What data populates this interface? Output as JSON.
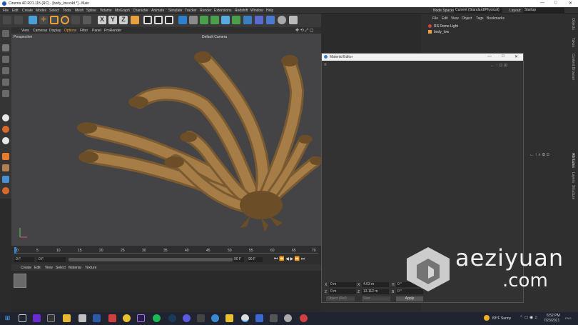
{
  "window": {
    "title": "Cinema 4D R21.115 (RC) - [body_low.c4d *] - Main"
  },
  "menubar": {
    "items": [
      "File",
      "Edit",
      "Create",
      "Modes",
      "Select",
      "Tools",
      "Mesh",
      "Spline",
      "Volume",
      "MoGraph",
      "Character",
      "Animate",
      "Simulate",
      "Tracker",
      "Render",
      "Extensions",
      "Redshift",
      "Window",
      "Help"
    ],
    "node_spaces_label": "Node Spaces:",
    "node_spaces_value": "Current (Standard/Physical)",
    "layout_label": "Layout:",
    "layout_value": "Startup"
  },
  "viewport": {
    "menu": [
      "View",
      "Cameras",
      "Display",
      "Options",
      "Filter",
      "Panel",
      "ProRender"
    ],
    "label": "Perspective",
    "camera": "Default Camera"
  },
  "timeline": {
    "ticks": [
      "0",
      "5",
      "10",
      "15",
      "20",
      "25",
      "30",
      "35",
      "40",
      "45",
      "50",
      "55",
      "60",
      "65",
      "70"
    ],
    "current": "0 F",
    "start": "0 F",
    "end": "90 F",
    "end2": "90 F"
  },
  "material_manager": {
    "menu": [
      "Create",
      "Edit",
      "View",
      "Select",
      "Material",
      "Texture"
    ]
  },
  "object_manager": {
    "menu": [
      "File",
      "Edit",
      "View",
      "Object",
      "Tags",
      "Bookmarks"
    ],
    "objects": [
      {
        "name": "RS Dome Light"
      },
      {
        "name": "body_low"
      }
    ]
  },
  "right_tabs": [
    "Objects",
    "Takes",
    "Content Browser",
    "Attributes",
    "Layers",
    "Structure"
  ],
  "material_editor": {
    "title": "Material Editor"
  },
  "coords": {
    "rows": [
      {
        "axis": "X",
        "pos": "0 m",
        "axis2": "X",
        "size": "4.03 m",
        "axis3": "H",
        "rot": "0 °"
      },
      {
        "axis": "Z",
        "pos": "0 m",
        "axis2": "Z",
        "size": "13.112 m",
        "axis3": "B",
        "rot": "0 °"
      }
    ],
    "mode1": "Object (Rel)",
    "mode2": "Size",
    "apply": "Apply"
  },
  "watermark": {
    "line1": "aeziyuan",
    "line2": ".com"
  },
  "taskbar": {
    "weather": "83°F Sunny",
    "time": "6:52 PM",
    "date": "7/23/2021",
    "lang": "ENG"
  },
  "colors": {
    "accent": "#4a9fd8",
    "active_timeline": "#3b7fd4",
    "model_tan": "#a67c47"
  }
}
